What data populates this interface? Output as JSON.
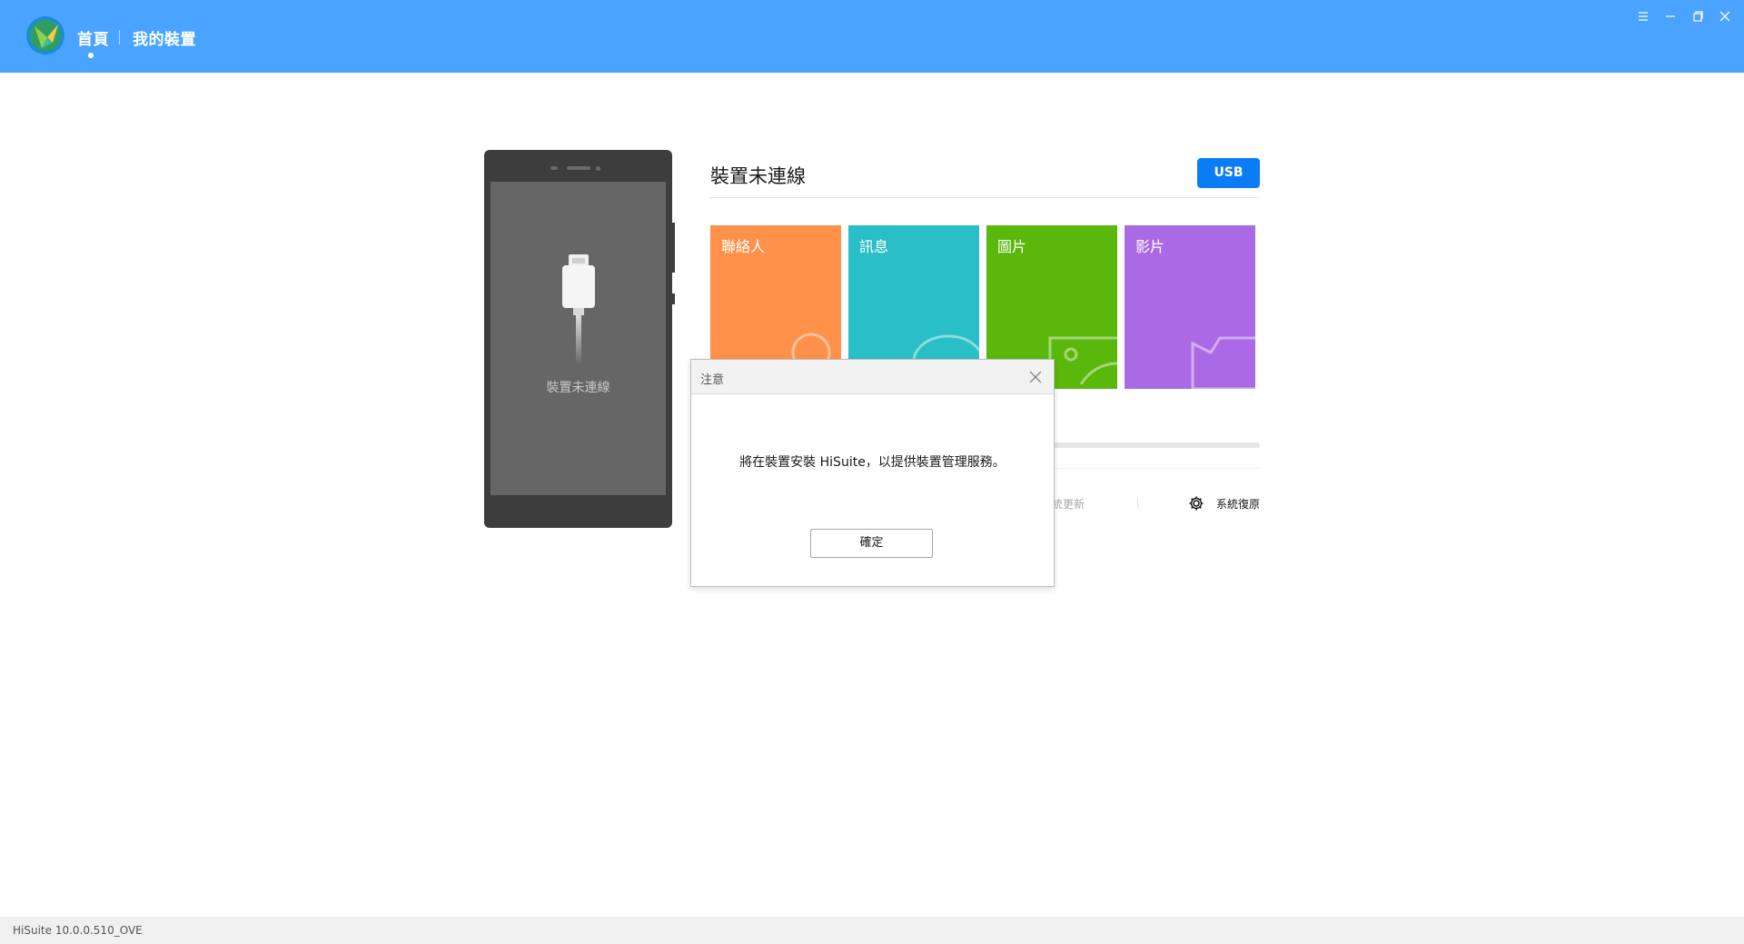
{
  "header": {
    "nav_home": "首頁",
    "nav_my_device": "我的裝置",
    "accent_color": "#4aa3ff",
    "window_controls": [
      "menu-icon",
      "minimize-icon",
      "restore-icon",
      "close-icon"
    ]
  },
  "phone": {
    "status_text": "裝置未連線"
  },
  "device": {
    "status_title": "裝置未連線",
    "usb_button": "USB",
    "usb_button_color": "#0a7cf5"
  },
  "tiles": [
    {
      "label": "聯絡人",
      "color": "#ff914a",
      "icon": "contacts-icon"
    },
    {
      "label": "訊息",
      "color": "#2abfc6",
      "icon": "messages-icon"
    },
    {
      "label": "圖片",
      "color": "#5ab70c",
      "icon": "pictures-icon"
    },
    {
      "label": "影片",
      "color": "#ab6ae5",
      "icon": "videos-icon"
    }
  ],
  "actions": {
    "update_partial": "統更新",
    "system_restore": "系統復原"
  },
  "dialog": {
    "title": "注意",
    "message": "將在裝置安裝 HiSuite，以提供裝置管理服務。",
    "ok_button": "確定"
  },
  "footer": {
    "version": "HiSuite 10.0.0.510_OVE"
  }
}
